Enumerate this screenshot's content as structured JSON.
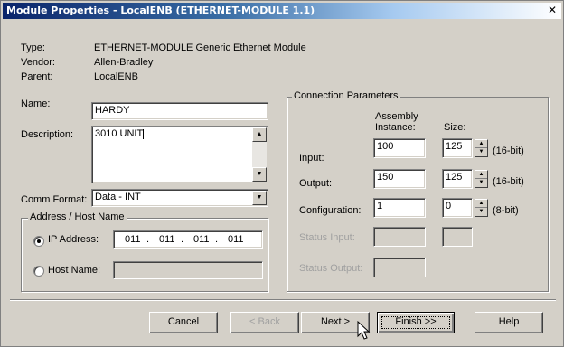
{
  "window": {
    "title": "Module Properties - LocalENB (ETHERNET-MODULE 1.1)",
    "close_glyph": "✕"
  },
  "info": {
    "type_label": "Type:",
    "type_value": "ETHERNET-MODULE Generic Ethernet Module",
    "vendor_label": "Vendor:",
    "vendor_value": "Allen-Bradley",
    "parent_label": "Parent:",
    "parent_value": "LocalENB"
  },
  "name": {
    "label": "Name:",
    "value": "HARDY"
  },
  "description": {
    "label": "Description:",
    "value": "3010 UNIT"
  },
  "comm_format": {
    "label": "Comm Format:",
    "value": "Data - INT"
  },
  "address_group": {
    "title": "Address / Host Name",
    "ip_label": "IP Address:",
    "ip_octets": [
      "011",
      "011",
      "011",
      "011"
    ],
    "ip_dot": ".",
    "host_label": "Host Name:",
    "host_value": ""
  },
  "connection": {
    "title": "Connection Parameters",
    "col_instance": "Assembly\nInstance:",
    "col_instance_l1": "Assembly",
    "col_instance_l2": "Instance:",
    "col_size": "Size:",
    "rows": [
      {
        "label": "Input:",
        "instance": "100",
        "size": "125",
        "unit": "(16-bit)",
        "enabled": true
      },
      {
        "label": "Output:",
        "instance": "150",
        "size": "125",
        "unit": "(16-bit)",
        "enabled": true
      },
      {
        "label": "Configuration:",
        "instance": "1",
        "size": "0",
        "unit": "(8-bit)",
        "enabled": true
      },
      {
        "label": "Status Input:",
        "instance": "",
        "size": "",
        "unit": "",
        "enabled": false
      },
      {
        "label": "Status Output:",
        "instance": "",
        "size": "",
        "unit": "",
        "enabled": false
      }
    ]
  },
  "buttons": {
    "cancel": "Cancel",
    "back": "< Back",
    "next": "Next >",
    "finish": "Finish >>",
    "help": "Help"
  },
  "icons": {
    "spin_up": "▲",
    "spin_down": "▼",
    "dropdown": "▼"
  }
}
